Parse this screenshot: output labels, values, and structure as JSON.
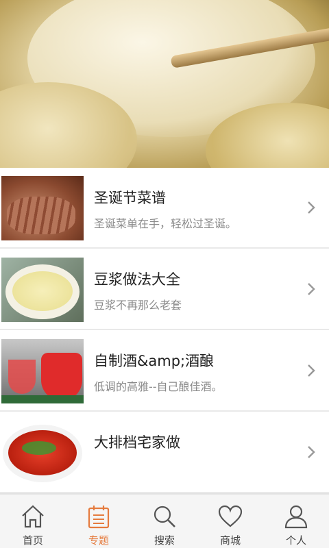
{
  "hero": {
    "image": "dumpling-with-chopsticks"
  },
  "items": [
    {
      "title": "圣诞节菜谱",
      "subtitle": "圣诞菜单在手，轻松过圣诞。",
      "thumb": "roast-meat"
    },
    {
      "title": "豆浆做法大全",
      "subtitle": "豆浆不再那么老套",
      "thumb": "soy-milk-bowl"
    },
    {
      "title": "自制酒&amp;酒酿",
      "subtitle": "低调的高雅--自己酿佳酒。",
      "thumb": "red-drink-glasses"
    },
    {
      "title": "大排档宅家做",
      "subtitle": "",
      "thumb": "crayfish-plate"
    }
  ],
  "tabs": [
    {
      "label": "首页",
      "icon": "home-icon",
      "active": false
    },
    {
      "label": "专题",
      "icon": "topics-icon",
      "active": true
    },
    {
      "label": "搜索",
      "icon": "search-icon",
      "active": false
    },
    {
      "label": "商城",
      "icon": "heart-icon",
      "active": false
    },
    {
      "label": "个人",
      "icon": "person-icon",
      "active": false
    }
  ],
  "colors": {
    "accent": "#e57b3e",
    "text": "#222222",
    "subtext": "#8a8a8a",
    "tabbar_bg": "#f5f5f5"
  }
}
